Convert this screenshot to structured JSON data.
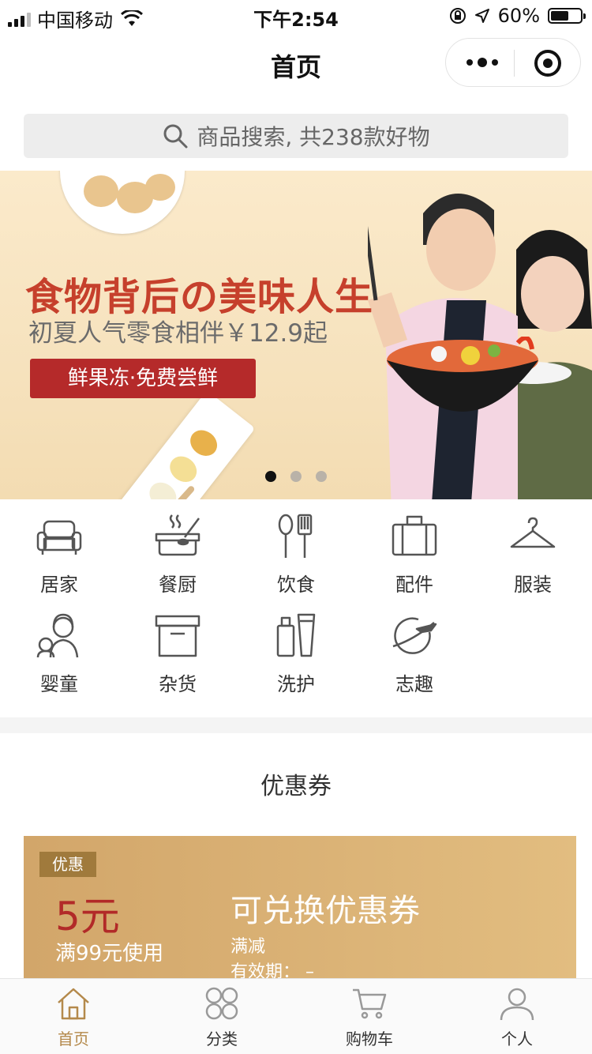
{
  "status_bar": {
    "carrier": "中国移动",
    "time": "下午2:54",
    "battery_percent": "60%",
    "battery_level": 0.6
  },
  "nav": {
    "title": "首页"
  },
  "search": {
    "placeholder": "商品搜索, 共238款好物"
  },
  "banner": {
    "headline": "食物背后の美味人生",
    "subline": "初夏人气零食相伴￥12.9起",
    "cta": "鲜果冻·免费尝鲜",
    "page_count": 3,
    "active_page": 1
  },
  "categories": [
    {
      "label": "居家",
      "icon": "sofa-icon"
    },
    {
      "label": "餐厨",
      "icon": "cooking-pot-icon"
    },
    {
      "label": "饮食",
      "icon": "spoon-spatula-icon"
    },
    {
      "label": "配件",
      "icon": "suitcase-icon"
    },
    {
      "label": "服装",
      "icon": "hanger-icon"
    },
    {
      "label": "婴童",
      "icon": "mother-child-icon"
    },
    {
      "label": "杂货",
      "icon": "storage-box-icon"
    },
    {
      "label": "洗护",
      "icon": "toiletry-bottles-icon"
    },
    {
      "label": "志趣",
      "icon": "planet-plane-icon"
    }
  ],
  "coupon_section": {
    "title": "优惠券",
    "coupon": {
      "tag": "优惠",
      "amount": "5元",
      "condition": "满99元使用",
      "name": "可兑换优惠券",
      "type": "满减",
      "validity": "有效期： –"
    }
  },
  "tabbar": [
    {
      "label": "首页",
      "icon": "home-icon",
      "active": true
    },
    {
      "label": "分类",
      "icon": "category-grid-icon",
      "active": false
    },
    {
      "label": "购物车",
      "icon": "cart-icon",
      "active": false
    },
    {
      "label": "个人",
      "icon": "user-icon",
      "active": false
    }
  ],
  "colors": {
    "accent_gold": "#b4894b",
    "banner_red": "#c6402c",
    "coupon_red": "#b22a28"
  }
}
